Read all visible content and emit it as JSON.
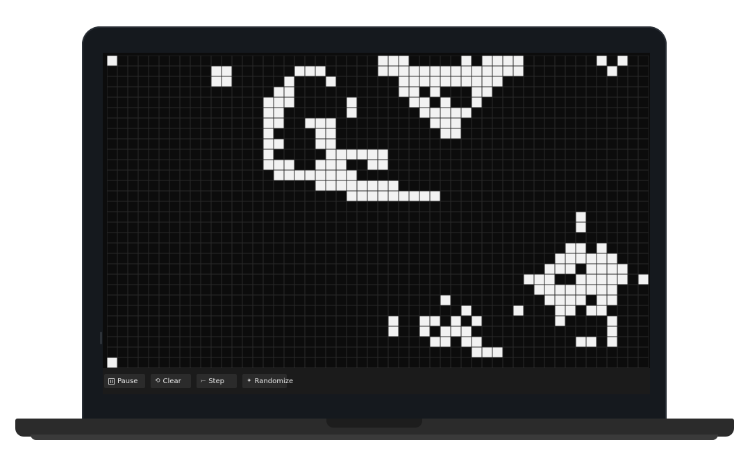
{
  "app": {
    "controls": {
      "pause_label": "Pause",
      "clear_label": "Clear",
      "step_label": "Step",
      "randomize_label": "Randomize",
      "clear_glyph": "⟲",
      "step_glyph": "⤚",
      "randomize_glyph": "✦"
    },
    "colors": {
      "alive": "#f2f2f2",
      "dead": "#0c0c0c",
      "grid_line": "#2a2a2a"
    }
  },
  "board": {
    "cols": 52,
    "rows": 30,
    "alive_cells": [
      [
        0,
        0
      ],
      [
        10,
        1
      ],
      [
        11,
        1
      ],
      [
        10,
        2
      ],
      [
        11,
        2
      ],
      [
        18,
        1
      ],
      [
        19,
        1
      ],
      [
        20,
        1
      ],
      [
        17,
        2
      ],
      [
        21,
        2
      ],
      [
        16,
        3
      ],
      [
        17,
        3
      ],
      [
        15,
        4
      ],
      [
        16,
        4
      ],
      [
        17,
        4
      ],
      [
        15,
        5
      ],
      [
        16,
        5
      ],
      [
        15,
        6
      ],
      [
        16,
        6
      ],
      [
        15,
        7
      ],
      [
        15,
        8
      ],
      [
        16,
        8
      ],
      [
        15,
        9
      ],
      [
        15,
        10
      ],
      [
        16,
        10
      ],
      [
        17,
        10
      ],
      [
        16,
        11
      ],
      [
        17,
        11
      ],
      [
        18,
        11
      ],
      [
        19,
        11
      ],
      [
        20,
        11
      ],
      [
        21,
        11
      ],
      [
        22,
        11
      ],
      [
        23,
        11
      ],
      [
        19,
        6
      ],
      [
        20,
        6
      ],
      [
        21,
        6
      ],
      [
        20,
        7
      ],
      [
        21,
        7
      ],
      [
        20,
        8
      ],
      [
        21,
        8
      ],
      [
        21,
        9
      ],
      [
        22,
        9
      ],
      [
        23,
        9
      ],
      [
        24,
        9
      ],
      [
        20,
        10
      ],
      [
        21,
        10
      ],
      [
        22,
        10
      ],
      [
        20,
        12
      ],
      [
        21,
        12
      ],
      [
        22,
        12
      ],
      [
        23,
        12
      ],
      [
        24,
        12
      ],
      [
        25,
        12
      ],
      [
        26,
        12
      ],
      [
        27,
        12
      ],
      [
        23,
        13
      ],
      [
        24,
        13
      ],
      [
        25,
        13
      ],
      [
        26,
        13
      ],
      [
        27,
        13
      ],
      [
        28,
        13
      ],
      [
        29,
        13
      ],
      [
        30,
        13
      ],
      [
        31,
        13
      ],
      [
        23,
        4
      ],
      [
        23,
        5
      ],
      [
        25,
        9
      ],
      [
        26,
        9
      ],
      [
        25,
        10
      ],
      [
        26,
        10
      ],
      [
        26,
        0
      ],
      [
        27,
        0
      ],
      [
        28,
        0
      ],
      [
        26,
        1
      ],
      [
        27,
        1
      ],
      [
        28,
        1
      ],
      [
        29,
        1
      ],
      [
        30,
        1
      ],
      [
        31,
        1
      ],
      [
        32,
        1
      ],
      [
        33,
        1
      ],
      [
        34,
        1
      ],
      [
        35,
        1
      ],
      [
        36,
        1
      ],
      [
        37,
        1
      ],
      [
        38,
        1
      ],
      [
        39,
        1
      ],
      [
        34,
        0
      ],
      [
        36,
        0
      ],
      [
        37,
        0
      ],
      [
        38,
        0
      ],
      [
        39,
        0
      ],
      [
        28,
        2
      ],
      [
        29,
        2
      ],
      [
        30,
        2
      ],
      [
        31,
        2
      ],
      [
        32,
        2
      ],
      [
        33,
        2
      ],
      [
        34,
        2
      ],
      [
        35,
        2
      ],
      [
        36,
        2
      ],
      [
        37,
        2
      ],
      [
        28,
        3
      ],
      [
        29,
        3
      ],
      [
        31,
        3
      ],
      [
        35,
        3
      ],
      [
        36,
        3
      ],
      [
        29,
        4
      ],
      [
        30,
        4
      ],
      [
        32,
        4
      ],
      [
        35,
        4
      ],
      [
        30,
        5
      ],
      [
        31,
        5
      ],
      [
        32,
        5
      ],
      [
        33,
        5
      ],
      [
        34,
        5
      ],
      [
        31,
        6
      ],
      [
        32,
        6
      ],
      [
        33,
        6
      ],
      [
        32,
        7
      ],
      [
        33,
        7
      ],
      [
        47,
        0
      ],
      [
        49,
        0
      ],
      [
        48,
        1
      ],
      [
        45,
        15
      ],
      [
        45,
        16
      ],
      [
        44,
        18
      ],
      [
        45,
        18
      ],
      [
        47,
        18
      ],
      [
        43,
        19
      ],
      [
        44,
        19
      ],
      [
        45,
        19
      ],
      [
        46,
        19
      ],
      [
        47,
        19
      ],
      [
        48,
        19
      ],
      [
        42,
        20
      ],
      [
        43,
        20
      ],
      [
        44,
        20
      ],
      [
        46,
        20
      ],
      [
        47,
        20
      ],
      [
        48,
        20
      ],
      [
        49,
        20
      ],
      [
        40,
        21
      ],
      [
        41,
        21
      ],
      [
        42,
        21
      ],
      [
        45,
        21
      ],
      [
        46,
        21
      ],
      [
        47,
        21
      ],
      [
        48,
        21
      ],
      [
        49,
        21
      ],
      [
        51,
        21
      ],
      [
        41,
        22
      ],
      [
        42,
        22
      ],
      [
        43,
        22
      ],
      [
        44,
        22
      ],
      [
        45,
        22
      ],
      [
        46,
        22
      ],
      [
        47,
        22
      ],
      [
        48,
        22
      ],
      [
        42,
        23
      ],
      [
        43,
        23
      ],
      [
        44,
        23
      ],
      [
        45,
        23
      ],
      [
        47,
        23
      ],
      [
        48,
        23
      ],
      [
        39,
        24
      ],
      [
        43,
        24
      ],
      [
        44,
        24
      ],
      [
        46,
        24
      ],
      [
        47,
        24
      ],
      [
        43,
        25
      ],
      [
        48,
        25
      ],
      [
        48,
        26
      ],
      [
        45,
        27
      ],
      [
        46,
        27
      ],
      [
        48,
        27
      ],
      [
        32,
        23
      ],
      [
        34,
        24
      ],
      [
        27,
        25
      ],
      [
        30,
        25
      ],
      [
        31,
        25
      ],
      [
        33,
        25
      ],
      [
        35,
        25
      ],
      [
        27,
        26
      ],
      [
        30,
        26
      ],
      [
        32,
        26
      ],
      [
        33,
        26
      ],
      [
        34,
        26
      ],
      [
        31,
        27
      ],
      [
        32,
        27
      ],
      [
        34,
        27
      ],
      [
        35,
        27
      ],
      [
        35,
        28
      ],
      [
        36,
        28
      ],
      [
        37,
        28
      ],
      [
        0,
        29
      ]
    ]
  }
}
